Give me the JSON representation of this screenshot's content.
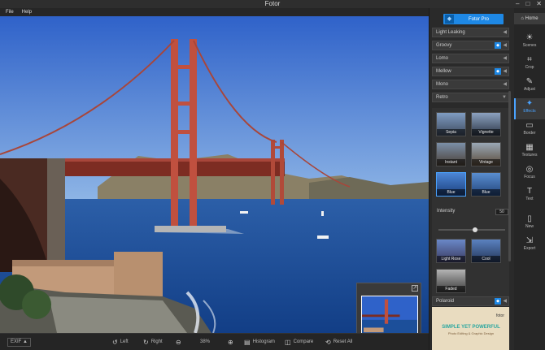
{
  "window": {
    "title": "Fotor",
    "controls": [
      "–",
      "□",
      "✕"
    ]
  },
  "menu": {
    "items": [
      "File",
      "Help"
    ]
  },
  "photo": {
    "description_colors": {
      "sky": "#2a63c8",
      "bridge": "#c84f3c",
      "water": "#1c4f9a"
    }
  },
  "thumbnail": {
    "expand_glyph": "↗"
  },
  "bottombar": {
    "exif": "EXIF ▲",
    "left": "Left",
    "right": "Right",
    "zoom": "38%",
    "histogram": "Histogram",
    "compare": "Compare",
    "reset": "Reset All"
  },
  "panel": {
    "pro_label": "Fotor Pro",
    "categories": [
      {
        "label": "Light Leaking",
        "badge": false
      },
      {
        "label": "Groovy",
        "badge": true
      },
      {
        "label": "Lomo",
        "badge": false
      },
      {
        "label": "Mellow",
        "badge": true
      },
      {
        "label": "Mono",
        "badge": false
      },
      {
        "label": "Retro",
        "badge": false
      }
    ],
    "effects_row1": [
      "Sepia",
      "Vignette"
    ],
    "effects_row2": [
      "Instant",
      "Vintage"
    ],
    "effects_row3": [
      "Blue",
      "Blue"
    ],
    "effects_row4": [
      "Light Rose",
      "Cool"
    ],
    "effects_row5": [
      "Faded"
    ],
    "intensity_label": "Intensity",
    "intensity_value": "50",
    "intensity_fraction": 0.5,
    "next_category": "Polaroid",
    "ad_headline": "SIMPLE YET POWERFUL",
    "ad_sub": "Photo Editing & Graphic Design",
    "ad_brand": "fotor"
  },
  "toolbar": {
    "home": "Home",
    "tools": [
      {
        "label": "Scenes",
        "icon": "☀"
      },
      {
        "label": "Crop",
        "icon": "⌗"
      },
      {
        "label": "Adjust",
        "icon": "✎"
      },
      {
        "label": "Effects",
        "icon": "✦"
      },
      {
        "label": "Border",
        "icon": "▭"
      },
      {
        "label": "Textures",
        "icon": "▦"
      },
      {
        "label": "Focus",
        "icon": "◎"
      },
      {
        "label": "Text",
        "icon": "T"
      },
      {
        "label": "New",
        "icon": "▯"
      },
      {
        "label": "Export",
        "icon": "⇲"
      }
    ]
  }
}
